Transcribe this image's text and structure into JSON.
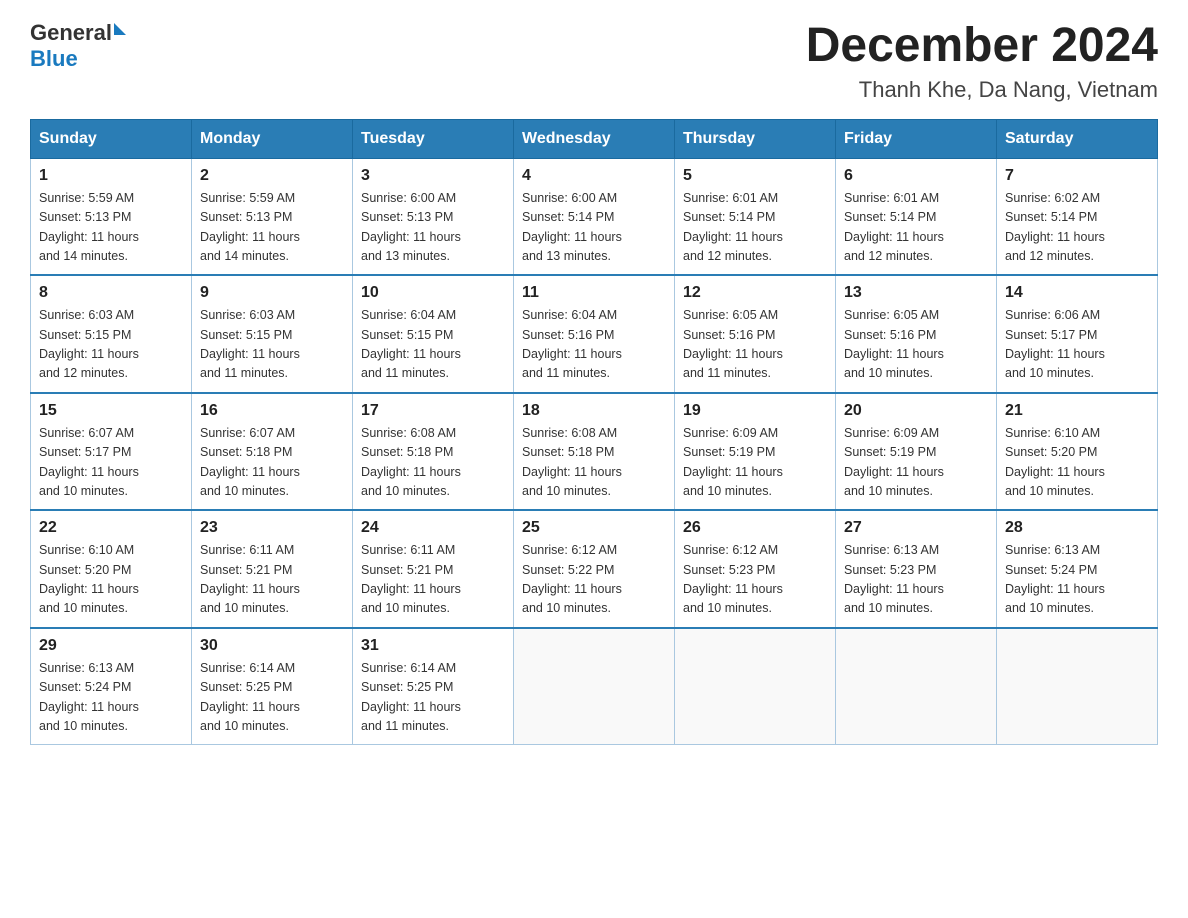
{
  "header": {
    "logo_text_general": "General",
    "logo_text_blue": "Blue",
    "month_year": "December 2024",
    "location": "Thanh Khe, Da Nang, Vietnam"
  },
  "days_of_week": [
    "Sunday",
    "Monday",
    "Tuesday",
    "Wednesday",
    "Thursday",
    "Friday",
    "Saturday"
  ],
  "weeks": [
    [
      {
        "day": "1",
        "sunrise": "5:59 AM",
        "sunset": "5:13 PM",
        "daylight": "11 hours and 14 minutes."
      },
      {
        "day": "2",
        "sunrise": "5:59 AM",
        "sunset": "5:13 PM",
        "daylight": "11 hours and 14 minutes."
      },
      {
        "day": "3",
        "sunrise": "6:00 AM",
        "sunset": "5:13 PM",
        "daylight": "11 hours and 13 minutes."
      },
      {
        "day": "4",
        "sunrise": "6:00 AM",
        "sunset": "5:14 PM",
        "daylight": "11 hours and 13 minutes."
      },
      {
        "day": "5",
        "sunrise": "6:01 AM",
        "sunset": "5:14 PM",
        "daylight": "11 hours and 12 minutes."
      },
      {
        "day": "6",
        "sunrise": "6:01 AM",
        "sunset": "5:14 PM",
        "daylight": "11 hours and 12 minutes."
      },
      {
        "day": "7",
        "sunrise": "6:02 AM",
        "sunset": "5:14 PM",
        "daylight": "11 hours and 12 minutes."
      }
    ],
    [
      {
        "day": "8",
        "sunrise": "6:03 AM",
        "sunset": "5:15 PM",
        "daylight": "11 hours and 12 minutes."
      },
      {
        "day": "9",
        "sunrise": "6:03 AM",
        "sunset": "5:15 PM",
        "daylight": "11 hours and 11 minutes."
      },
      {
        "day": "10",
        "sunrise": "6:04 AM",
        "sunset": "5:15 PM",
        "daylight": "11 hours and 11 minutes."
      },
      {
        "day": "11",
        "sunrise": "6:04 AM",
        "sunset": "5:16 PM",
        "daylight": "11 hours and 11 minutes."
      },
      {
        "day": "12",
        "sunrise": "6:05 AM",
        "sunset": "5:16 PM",
        "daylight": "11 hours and 11 minutes."
      },
      {
        "day": "13",
        "sunrise": "6:05 AM",
        "sunset": "5:16 PM",
        "daylight": "11 hours and 10 minutes."
      },
      {
        "day": "14",
        "sunrise": "6:06 AM",
        "sunset": "5:17 PM",
        "daylight": "11 hours and 10 minutes."
      }
    ],
    [
      {
        "day": "15",
        "sunrise": "6:07 AM",
        "sunset": "5:17 PM",
        "daylight": "11 hours and 10 minutes."
      },
      {
        "day": "16",
        "sunrise": "6:07 AM",
        "sunset": "5:18 PM",
        "daylight": "11 hours and 10 minutes."
      },
      {
        "day": "17",
        "sunrise": "6:08 AM",
        "sunset": "5:18 PM",
        "daylight": "11 hours and 10 minutes."
      },
      {
        "day": "18",
        "sunrise": "6:08 AM",
        "sunset": "5:18 PM",
        "daylight": "11 hours and 10 minutes."
      },
      {
        "day": "19",
        "sunrise": "6:09 AM",
        "sunset": "5:19 PM",
        "daylight": "11 hours and 10 minutes."
      },
      {
        "day": "20",
        "sunrise": "6:09 AM",
        "sunset": "5:19 PM",
        "daylight": "11 hours and 10 minutes."
      },
      {
        "day": "21",
        "sunrise": "6:10 AM",
        "sunset": "5:20 PM",
        "daylight": "11 hours and 10 minutes."
      }
    ],
    [
      {
        "day": "22",
        "sunrise": "6:10 AM",
        "sunset": "5:20 PM",
        "daylight": "11 hours and 10 minutes."
      },
      {
        "day": "23",
        "sunrise": "6:11 AM",
        "sunset": "5:21 PM",
        "daylight": "11 hours and 10 minutes."
      },
      {
        "day": "24",
        "sunrise": "6:11 AM",
        "sunset": "5:21 PM",
        "daylight": "11 hours and 10 minutes."
      },
      {
        "day": "25",
        "sunrise": "6:12 AM",
        "sunset": "5:22 PM",
        "daylight": "11 hours and 10 minutes."
      },
      {
        "day": "26",
        "sunrise": "6:12 AM",
        "sunset": "5:23 PM",
        "daylight": "11 hours and 10 minutes."
      },
      {
        "day": "27",
        "sunrise": "6:13 AM",
        "sunset": "5:23 PM",
        "daylight": "11 hours and 10 minutes."
      },
      {
        "day": "28",
        "sunrise": "6:13 AM",
        "sunset": "5:24 PM",
        "daylight": "11 hours and 10 minutes."
      }
    ],
    [
      {
        "day": "29",
        "sunrise": "6:13 AM",
        "sunset": "5:24 PM",
        "daylight": "11 hours and 10 minutes."
      },
      {
        "day": "30",
        "sunrise": "6:14 AM",
        "sunset": "5:25 PM",
        "daylight": "11 hours and 10 minutes."
      },
      {
        "day": "31",
        "sunrise": "6:14 AM",
        "sunset": "5:25 PM",
        "daylight": "11 hours and 11 minutes."
      },
      null,
      null,
      null,
      null
    ]
  ],
  "labels": {
    "sunrise": "Sunrise:",
    "sunset": "Sunset:",
    "daylight": "Daylight:"
  }
}
